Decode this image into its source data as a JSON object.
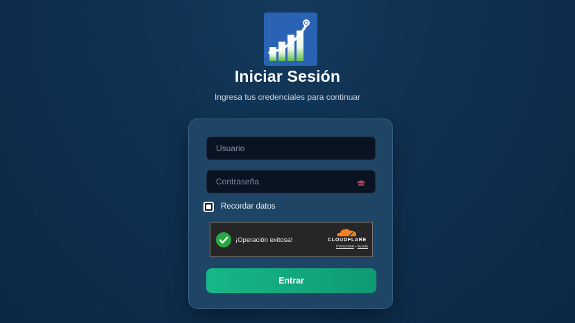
{
  "logo": {
    "icon": "growth-chart-logo-icon",
    "bg_color": "#2a63b4"
  },
  "header": {
    "title": "Iniciar Sesión",
    "subtitle": "Ingresa tus credenciales para continuar"
  },
  "form": {
    "username": {
      "placeholder": "Usuario",
      "value": ""
    },
    "password": {
      "placeholder": "Contraseña",
      "value": "",
      "toggle_icon": "eye-toggle-icon"
    },
    "remember": {
      "label": "Recordar datos",
      "checked": true
    },
    "submit_label": "Entrar",
    "submit_color": "#17b789"
  },
  "captcha": {
    "message": "¡Operación exitosa!",
    "status_icon": "success-check-icon",
    "success_color": "#29a745",
    "provider": "CLOUDFLARE",
    "provider_color": "#f48120",
    "privacy_label": "Privacidad",
    "separator": "•",
    "help_label": "Ayuda"
  }
}
